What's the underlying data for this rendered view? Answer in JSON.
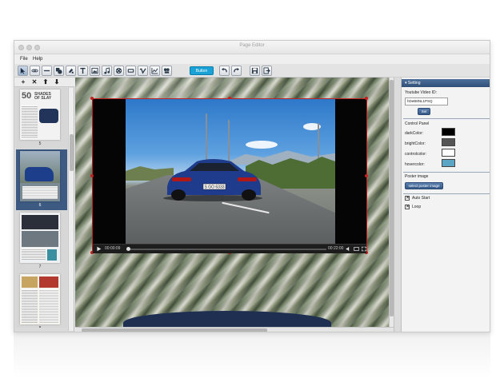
{
  "window": {
    "title": "Page Editor"
  },
  "menu": {
    "items": [
      "File",
      "Help"
    ]
  },
  "toolbar": {
    "tools": [
      "select-icon",
      "link-icon",
      "line-icon",
      "shape-icon",
      "color-icon",
      "text-icon",
      "image-icon",
      "audio-icon",
      "video-icon",
      "youtube-icon",
      "vimeo-icon",
      "chart-icon",
      "slideshow-icon"
    ],
    "button_label": "Button",
    "undo": "undo-icon",
    "redo": "redo-icon",
    "save": "save-icon",
    "exit": "exit-icon"
  },
  "pages_panel": {
    "tools": [
      "+",
      "✕",
      "⬆",
      "⬇"
    ],
    "pages": [
      {
        "number": "5",
        "cover_lines": [
          "50",
          "SHADES",
          "OF SLAY"
        ]
      },
      {
        "number": "6",
        "selected": true
      },
      {
        "number": "7"
      },
      {
        "number": "8"
      }
    ]
  },
  "player": {
    "current_time": "00:00:09",
    "total_time": "00:22:00",
    "plate": "S GO 6333"
  },
  "settings": {
    "header": "Setting",
    "youtube_label": "Youtube Video ID:",
    "youtube_value": "hDeB8NL1PSQ",
    "set_label": "Set",
    "control_panel_label": "Control Panel",
    "colors": [
      {
        "label": "darkColor:",
        "value": "#000000"
      },
      {
        "label": "brightColor:",
        "value": "#555555"
      },
      {
        "label": "controlcolor:",
        "value": "#ffffff"
      },
      {
        "label": "hovercolor:",
        "value": "#5aa6c4"
      }
    ],
    "poster_label": "Poster image",
    "poster_button": "select poster image",
    "auto_start": {
      "label": "Auto Start",
      "checked": true
    },
    "loop": {
      "label": "Loop",
      "checked": true
    }
  }
}
